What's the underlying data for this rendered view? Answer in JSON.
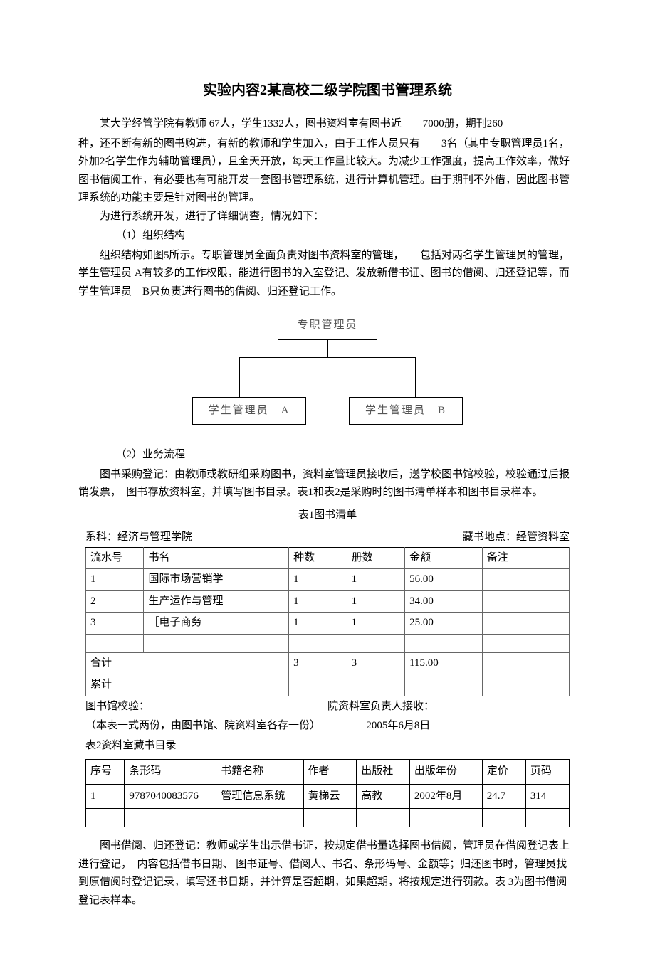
{
  "title": "实验内容2某高校二级学院图书管理系统",
  "paragraphs": {
    "p1": "某大学经管学院有教师 67人，学生1332人，图书资料室有图书近　　7000册，期刊260",
    "p2": "种，还不断有新的图书购进，有新的教师和学生加入，由于工作人员只有　　3名（其中专职管理员1名，外加2名学生作为辅助管理员），且全天开放，每天工作量比较大。为减少工作强度，提高工作效率，做好图书借阅工作，有必要也有可能开发一套图书管理系统，进行计算机管理。由于期刊不外借，因此图书管理系统的功能主要是针对图书的管理。",
    "p3": "为进行系统开发，进行了详细调查，情况如下：",
    "s1": "（1）组织结构",
    "p4": "组织结构如图5所示。专职管理员全面负责对图书资料室的管理，　　包括对两名学生管理员的管理，学生管理员 A有较多的工作权限，能进行图书的入室登记、发放新借书证、图书的借阅、归还登记等，而学生管理员　B只负责进行图书的借阅、归还登记工作。",
    "s2": "（2）业务流程",
    "p5": "图书采购登记：由教师或教研组采购图书，资料室管理员接收后，送学校图书馆校验，校验通过后报销发票，　图书存放资料室，并填写图书目录。表1和表2是采购时的图书清单样本和图书目录样本。",
    "p6": "图书借阅、归还登记：教师或学生出示借书证，按规定借书量选择图书借阅，管理员在借阅登记表上进行登记，　内容包括借书日期、 图书证号、借阅人、书名、条形码号、金额等；归还图书时，管理员找到原借阅时登记记录，填写还书日期，并计算是否超期，如果超期，将按规定进行罚款。表 3为图书借阅登记表样本。"
  },
  "diagram": {
    "top": "专职管理员",
    "left": "学生管理员　A",
    "right": "学生管理员　B"
  },
  "table1": {
    "caption": "表1图书清单",
    "meta_left": "系科：经济与管理学院",
    "meta_right": "藏书地点：经管资料室",
    "headers": [
      "流水号",
      "书名",
      "种数",
      "册数",
      "金额",
      "备注"
    ],
    "rows": [
      [
        "1",
        "国际市场营销学",
        "1",
        "1",
        "56.00",
        ""
      ],
      [
        "2",
        "生产运作与管理",
        "1",
        "1",
        "34.00",
        ""
      ],
      [
        "3",
        "［电子商务",
        "1",
        "1",
        "25.00",
        ""
      ],
      [
        "",
        "",
        "",
        "",
        "",
        ""
      ]
    ],
    "sum_row": [
      "合计",
      "3",
      "3",
      "115.00",
      ""
    ],
    "acc_row": [
      "累计",
      "",
      "",
      "",
      ""
    ],
    "foot1_left": "图书馆校验：",
    "foot1_right": "院资料室负责人接收：",
    "foot2_left": "（本表一式两份，由图书馆、院资料室各存一份）",
    "foot2_right": "2005年6月8日"
  },
  "table2": {
    "caption": "表2资料室藏书目录",
    "headers": [
      "序号",
      "条形码",
      "书籍名称",
      "作者",
      "出版社",
      "出版年份",
      "定价",
      "页码"
    ],
    "rows": [
      [
        "1",
        "9787040083576",
        "管理信息系统",
        "黄梯云",
        "高教",
        "2002年8月",
        "24.7",
        "314"
      ],
      [
        "",
        "",
        "",
        "",
        "",
        "",
        "",
        ""
      ]
    ]
  }
}
